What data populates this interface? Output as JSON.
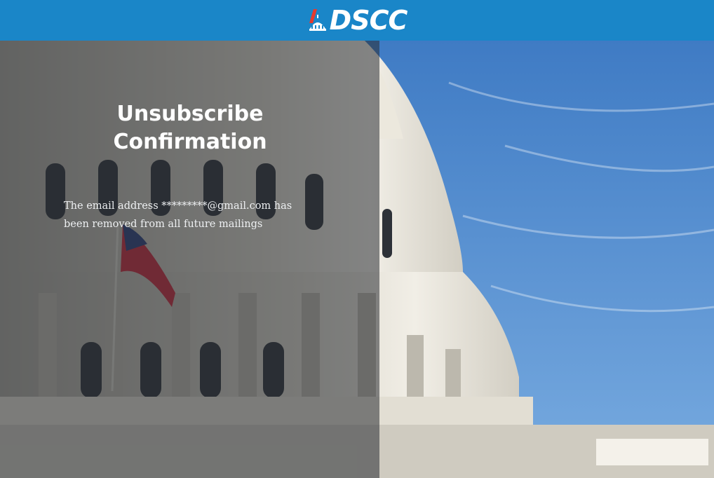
{
  "header": {
    "logo_text": "DSCC",
    "logo_icon": "capitol-dome-icon",
    "background_color": "#1a86c8"
  },
  "hero": {
    "image": "us-capitol-dome-photo",
    "overlay_color": "#282c32"
  },
  "confirmation": {
    "title_line1": "Unsubscribe",
    "title_line2": "Confirmation",
    "message": "The email address *********@gmail.com has been removed from all future mailings"
  }
}
